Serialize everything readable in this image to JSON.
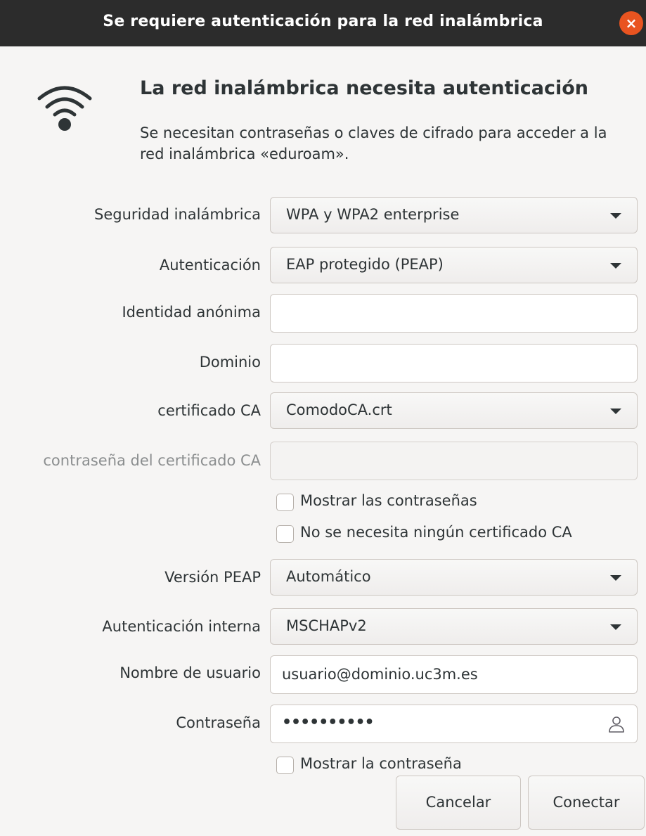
{
  "window": {
    "title": "Se requiere autenticación para la red inalámbrica",
    "close_icon": "close-icon",
    "close_glyph": "×"
  },
  "header": {
    "icon": "wifi-icon",
    "heading": "La red inalámbrica necesita autenticación",
    "description": "Se necesitan contraseñas o claves de cifrado para acceder a la red inalámbrica «eduroam»."
  },
  "form": {
    "wireless_security": {
      "label": "Seguridad inalámbrica",
      "value": "WPA y WPA2 enterprise"
    },
    "authentication": {
      "label": "Autenticación",
      "value": "EAP protegido (PEAP)"
    },
    "anonymous_identity": {
      "label": "Identidad anónima",
      "value": ""
    },
    "domain": {
      "label": "Dominio",
      "value": ""
    },
    "ca_certificate": {
      "label": "certificado CA",
      "value": "ComodoCA.crt"
    },
    "ca_certificate_password": {
      "label": "contraseña del certificado CA",
      "value": "",
      "disabled": true
    },
    "show_passwords": {
      "label": "Mostrar las contraseñas",
      "checked": false
    },
    "no_ca_certificate": {
      "label": "No se necesita ningún certificado CA",
      "checked": false
    },
    "peap_version": {
      "label": "Versión PEAP",
      "value": "Automático"
    },
    "inner_authentication": {
      "label": "Autenticación interna",
      "value": "MSCHAPv2"
    },
    "username": {
      "label": "Nombre de usuario",
      "value": "usuario@dominio.uc3m.es"
    },
    "password": {
      "label": "Contraseña",
      "masked_value": "••••••••••",
      "icon": "user-icon"
    },
    "show_password": {
      "label": "Mostrar la contraseña",
      "checked": false
    }
  },
  "buttons": {
    "cancel": "Cancelar",
    "connect": "Conectar"
  },
  "colors": {
    "titlebar_bg": "#2c2c2c",
    "close_button": "#e95420",
    "window_bg": "#f6f5f4",
    "text": "#2e3436",
    "disabled_text": "#8b8e8f"
  }
}
